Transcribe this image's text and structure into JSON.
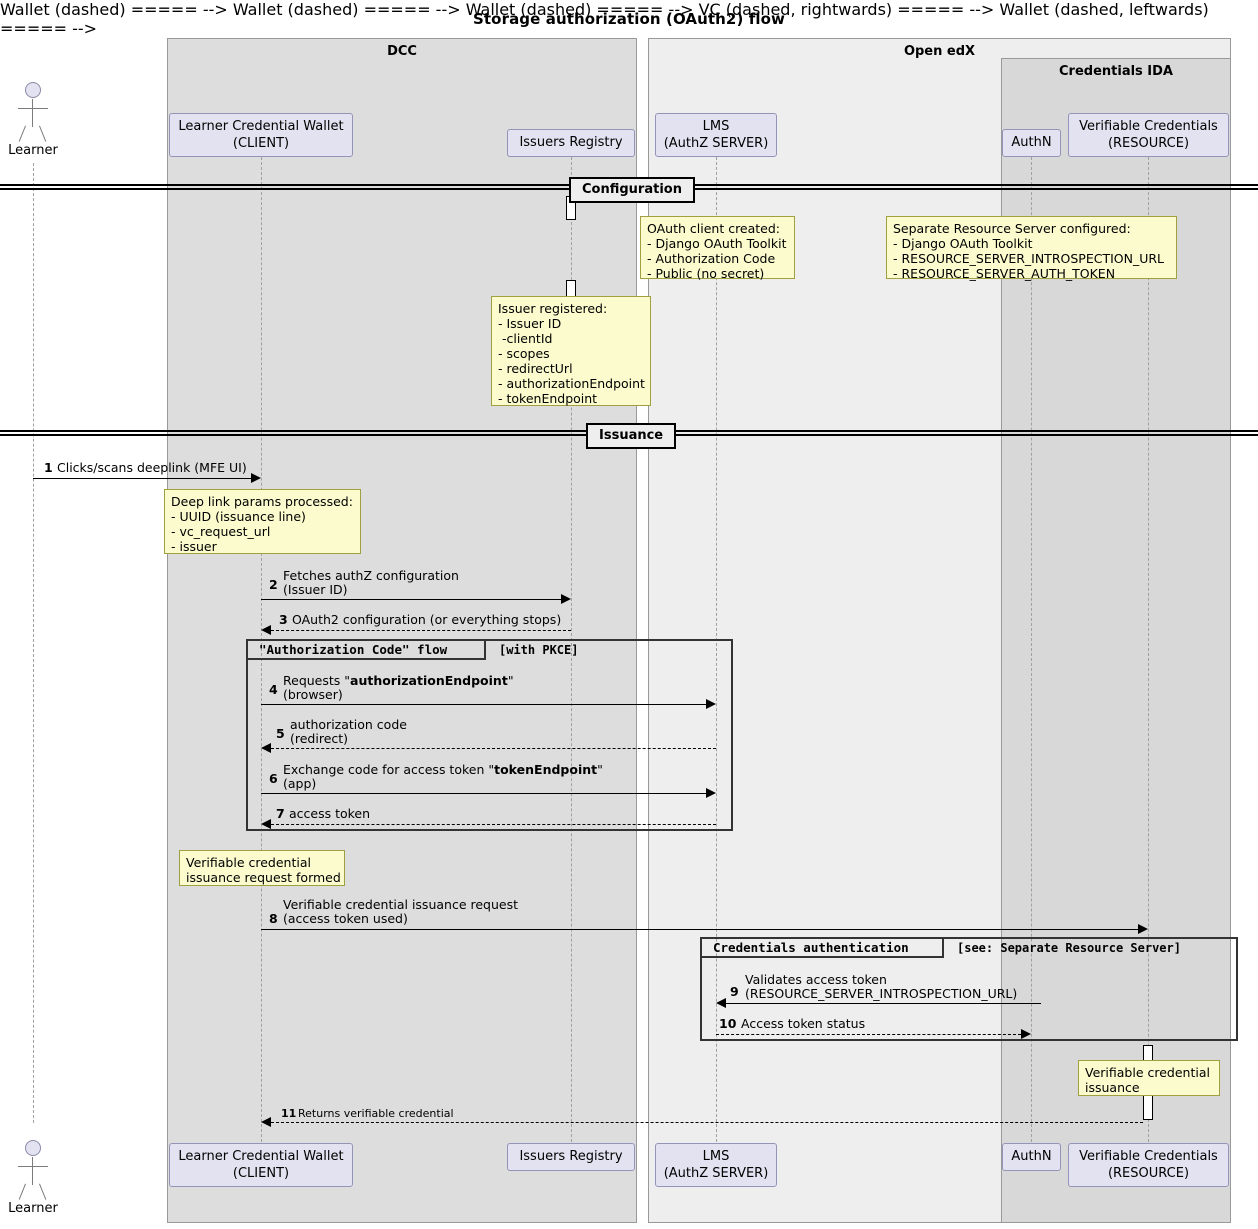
{
  "title": "Storage authorization (OAuth2) flow",
  "groups": [
    {
      "id": "dcc",
      "label": "DCC"
    },
    {
      "id": "openedx",
      "label": "Open edX"
    },
    {
      "id": "ida",
      "label": "Credentials IDA"
    }
  ],
  "actor": {
    "label": "Learner",
    "icon": "actor-stick-figure"
  },
  "participants": [
    {
      "id": "wallet",
      "line1": "Learner Credential Wallet",
      "line2": "(CLIENT)"
    },
    {
      "id": "registry",
      "line1": "Issuers Registry",
      "line2": ""
    },
    {
      "id": "lms",
      "line1": "LMS",
      "line2": "(AuthZ SERVER)"
    },
    {
      "id": "authn",
      "line1": "AuthN",
      "line2": ""
    },
    {
      "id": "vc",
      "line1": "Verifiable Credentials",
      "line2": "(RESOURCE)"
    }
  ],
  "dividers": [
    {
      "id": "configuration",
      "label": "Configuration"
    },
    {
      "id": "issuance",
      "label": "Issuance"
    }
  ],
  "notes": [
    {
      "id": "oauth-client-created",
      "text": "OAuth client created:\n- Django OAuth Toolkit\n- Authorization Code\n- Public (no secret)"
    },
    {
      "id": "separate-resource-server",
      "text": "Separate Resource Server configured:\n- Django OAuth Toolkit\n- RESOURCE_SERVER_INTROSPECTION_URL\n- RESOURCE_SERVER_AUTH_TOKEN"
    },
    {
      "id": "issuer-registered",
      "text": "Issuer registered:\n- Issuer ID\n -clientId\n- scopes\n- redirectUrl\n- authorizationEndpoint\n- tokenEndpoint"
    },
    {
      "id": "deep-link-params",
      "text": "Deep link params processed:\n- UUID (issuance line)\n- vc_request_url\n- issuer"
    },
    {
      "id": "vc-request-formed",
      "text": "Verifiable credential\nissuance request formed"
    },
    {
      "id": "vc-issuance",
      "text": "Verifiable credential\nissuance"
    }
  ],
  "frames": [
    {
      "id": "authorization-code-flow",
      "label": "\"Authorization Code\"  flow",
      "condition": "[with PKCE]"
    },
    {
      "id": "credentials-authentication",
      "label": "Credentials authentication",
      "condition": "[see: Separate Resource Server]"
    }
  ],
  "messages": [
    {
      "num": "1",
      "line1": "Clicks/scans deeplink (MFE UI)",
      "line2": "",
      "style": "solid"
    },
    {
      "num": "2",
      "line1": "Fetches authZ configuration",
      "line2": "(Issuer ID)",
      "style": "solid"
    },
    {
      "num": "3",
      "line1": "OAuth2 configuration (or everything stops)",
      "line2": "",
      "style": "dashed"
    },
    {
      "num": "4",
      "line1": "Requests \"authorizationEndpoint\"",
      "line2": "(browser)",
      "style": "solid",
      "bold_part": "authorizationEndpoint"
    },
    {
      "num": "5",
      "line1": "authorization code",
      "line2": "(redirect)",
      "style": "dashed"
    },
    {
      "num": "6",
      "line1": "Exchange code for access token \"tokenEndpoint\"",
      "line2": "(app)",
      "style": "solid",
      "bold_part": "tokenEndpoint"
    },
    {
      "num": "7",
      "line1": "access token",
      "line2": "",
      "style": "dashed"
    },
    {
      "num": "8",
      "line1": "Verifiable credential issuance request",
      "line2": "(access token used)",
      "style": "solid"
    },
    {
      "num": "9",
      "line1": "Validates access token",
      "line2": "(RESOURCE_SERVER_INTROSPECTION_URL)",
      "style": "solid"
    },
    {
      "num": "10",
      "line1": "Access token status",
      "line2": "",
      "style": "dashed"
    },
    {
      "num": "11",
      "line1": "Returns verifiable credential",
      "line2": "",
      "style": "dashed"
    }
  ],
  "colors": {
    "group_dcc": "#DDDDDD",
    "group_openedx": "#EEEEEE",
    "group_ida": "#D8D8D8",
    "participant_fill": "#E2E2F0",
    "participant_border": "#9494B8",
    "note_fill": "#FBFBCE",
    "note_border": "#A0A040",
    "line": "#000000"
  }
}
